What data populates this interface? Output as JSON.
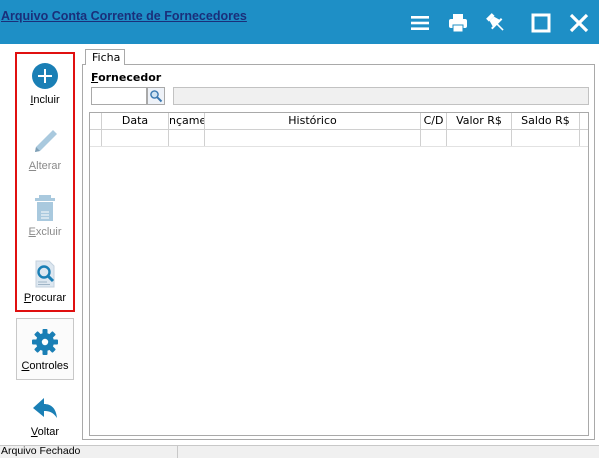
{
  "window": {
    "title": "Arquivo Conta Corrente de Fornecedores",
    "controls": [
      {
        "icon": "hamburger-menu-icon"
      },
      {
        "icon": "printer-icon"
      },
      {
        "icon": "pin-icon"
      },
      {
        "icon": "maximize-icon"
      },
      {
        "icon": "close-icon"
      }
    ]
  },
  "toolbar": {
    "incluir": {
      "label": "Incluir",
      "icon": "plus-circle-icon",
      "enabled": true
    },
    "alterar": {
      "label": "Alterar",
      "icon": "pencil-icon",
      "enabled": false
    },
    "excluir": {
      "label": "Excluir",
      "icon": "trash-icon",
      "enabled": false
    },
    "procurar": {
      "label": "Procurar",
      "icon": "document-search-icon",
      "enabled": true
    },
    "controles": {
      "label": "Controles",
      "icon": "gear-icon",
      "enabled": true
    },
    "voltar": {
      "label": "Voltar",
      "icon": "back-arrow-icon",
      "enabled": true
    }
  },
  "tabs": [
    {
      "label": "Ficha",
      "active": true
    }
  ],
  "form": {
    "fornecedor_label": "Fornecedor",
    "code_value": "",
    "name_value": "",
    "lookup_icon": "magnifier-icon"
  },
  "grid": {
    "columns": [
      "",
      "Data",
      "nçame",
      "Histórico",
      "C/D",
      "Valor R$",
      "Saldo R$"
    ],
    "rows": [
      [
        "",
        "",
        "",
        "",
        "",
        "",
        ""
      ]
    ]
  },
  "status": {
    "text": "Arquivo Fechado"
  },
  "colors": {
    "titlebar": "#1e8fc6",
    "title_text": "#1a2f7a",
    "accent": "#1a7fb5",
    "highlight_border": "#e01010"
  }
}
